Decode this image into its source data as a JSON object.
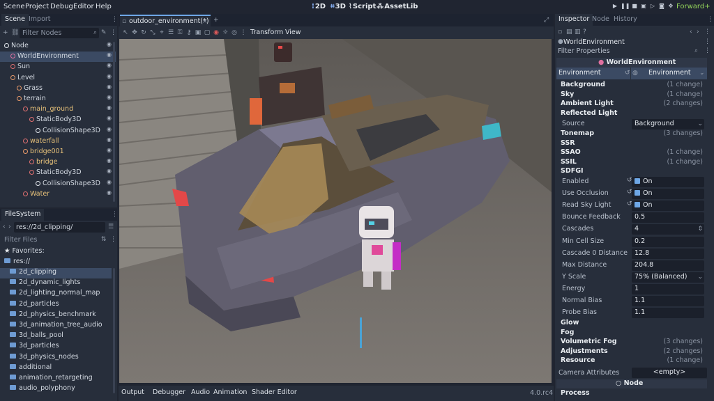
{
  "menu": [
    "Scene",
    "Project",
    "Debug",
    "Editor",
    "Help"
  ],
  "workspaces": {
    "w2d": "2D",
    "w3d": "3D",
    "script": "Script",
    "assetlib": "AssetLib"
  },
  "renderer": "Forward+",
  "scene_dock": {
    "tabs": [
      "Scene",
      "Import"
    ],
    "filter_placeholder": "Filter Nodes",
    "nodes": [
      {
        "label": "Node",
        "depth": 0,
        "icon": "node-icon"
      },
      {
        "label": "WorldEnvironment",
        "depth": 1,
        "icon": "world-icon",
        "selected": true
      },
      {
        "label": "Sun",
        "depth": 1,
        "icon": "light-icon"
      },
      {
        "label": "Level",
        "depth": 1,
        "icon": "node3d-icon"
      },
      {
        "label": "Grass",
        "depth": 2,
        "icon": "node3d-icon"
      },
      {
        "label": "terrain",
        "depth": 2,
        "icon": "node3d-icon"
      },
      {
        "label": "main_ground",
        "depth": 3,
        "icon": "mesh-icon"
      },
      {
        "label": "StaticBody3D",
        "depth": 4,
        "icon": "body-icon"
      },
      {
        "label": "CollisionShape3D",
        "depth": 5,
        "icon": "shape-icon"
      },
      {
        "label": "waterfall",
        "depth": 3,
        "icon": "mesh-icon"
      },
      {
        "label": "bridge001",
        "depth": 3,
        "icon": "node3d-icon"
      },
      {
        "label": "bridge",
        "depth": 4,
        "icon": "mesh-icon"
      },
      {
        "label": "StaticBody3D",
        "depth": 4,
        "icon": "body-icon"
      },
      {
        "label": "CollisionShape3D",
        "depth": 5,
        "icon": "shape-icon"
      },
      {
        "label": "Water",
        "depth": 3,
        "icon": "mesh-icon"
      }
    ]
  },
  "filesystem": {
    "tab": "FileSystem",
    "path": "res://2d_clipping/",
    "filter_placeholder": "Filter Files",
    "favorites": "Favorites:",
    "root": "res://",
    "folders": [
      "2d_clipping",
      "2d_dynamic_lights",
      "2d_lighting_normal_map",
      "2d_particles",
      "2d_physics_benchmark",
      "3d_animation_tree_audio",
      "3d_balls_pool",
      "3d_particles",
      "3d_physics_nodes",
      "additional",
      "animation_retargeting",
      "audio_polyphony"
    ]
  },
  "editor": {
    "tab": "outdoor_environment(*)",
    "transform": "Transform",
    "view": "View"
  },
  "bottom": {
    "tabs": [
      "Output",
      "Debugger",
      "Audio",
      "Animation",
      "Shader Editor"
    ],
    "version": "4.0.rc4"
  },
  "inspector": {
    "tabs": [
      "Inspector",
      "Node",
      "History"
    ],
    "object": "WorldEnvironment",
    "filter_placeholder": "Filter Properties",
    "header": "WorldEnvironment",
    "env_label": "Environment",
    "env_value": "Environment",
    "sections1": [
      {
        "label": "Background",
        "changes": "(1 change)"
      },
      {
        "label": "Sky",
        "changes": "(1 change)"
      },
      {
        "label": "Ambient Light",
        "changes": "(2 changes)"
      },
      {
        "label": "Reflected Light",
        "changes": ""
      }
    ],
    "source_label": "Source",
    "source_value": "Background",
    "sections2": [
      {
        "label": "Tonemap",
        "changes": "(3 changes)"
      },
      {
        "label": "SSR",
        "changes": ""
      },
      {
        "label": "SSAO",
        "changes": "(1 change)"
      },
      {
        "label": "SSIL",
        "changes": "(1 change)"
      },
      {
        "label": "SDFGI",
        "changes": ""
      }
    ],
    "sdfgi": [
      {
        "label": "Enabled",
        "value": "On",
        "kind": "check"
      },
      {
        "label": "Use Occlusion",
        "value": "On",
        "kind": "check"
      },
      {
        "label": "Read Sky Light",
        "value": "On",
        "kind": "check"
      },
      {
        "label": "Bounce Feedback",
        "value": "0.5",
        "kind": "num"
      },
      {
        "label": "Cascades",
        "value": "4",
        "kind": "spin"
      },
      {
        "label": "Min Cell Size",
        "value": "0.2",
        "kind": "num"
      },
      {
        "label": "Cascade 0 Distance",
        "value": "12.8",
        "kind": "num"
      },
      {
        "label": "Max Distance",
        "value": "204.8",
        "kind": "num"
      },
      {
        "label": "Y Scale",
        "value": "75% (Balanced)",
        "kind": "select"
      },
      {
        "label": "Energy",
        "value": "1",
        "kind": "num"
      },
      {
        "label": "Normal Bias",
        "value": "1.1",
        "kind": "num"
      },
      {
        "label": "Probe Bias",
        "value": "1.1",
        "kind": "num"
      }
    ],
    "sections3": [
      {
        "label": "Glow",
        "changes": ""
      },
      {
        "label": "Fog",
        "changes": ""
      },
      {
        "label": "Volumetric Fog",
        "changes": "(3 changes)"
      },
      {
        "label": "Adjustments",
        "changes": "(2 changes)"
      },
      {
        "label": "Resource",
        "changes": "(1 change)"
      }
    ],
    "camera_label": "Camera Attributes",
    "camera_value": "<empty>",
    "node_header": "Node",
    "process": "Process"
  }
}
